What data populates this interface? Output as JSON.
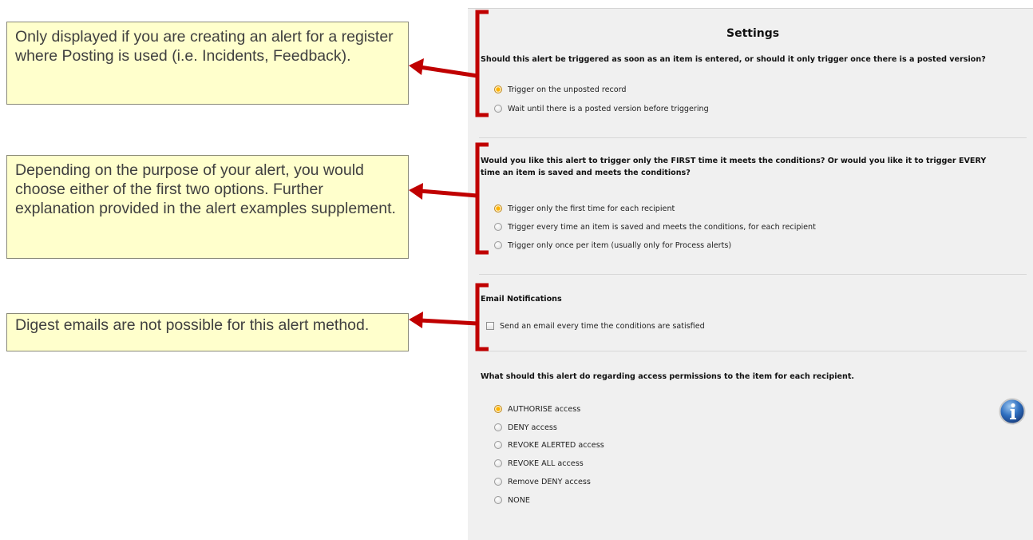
{
  "callouts": {
    "posting": "Only displayed if you are creating an alert for a register where Posting is used (i.e. Incidents, Feedback).",
    "trigger": "Depending on the purpose of your alert, you would choose either of the first two options. Further explanation provided in the alert examples supplement.",
    "digest": "Digest emails are not possible for this alert method."
  },
  "settings": {
    "title": "Settings",
    "posting_question": "Should this alert be triggered as soon as an item is entered, or should it only trigger once there is a posted version?",
    "posting_options": [
      {
        "label": "Trigger on the unposted record",
        "selected": true
      },
      {
        "label": "Wait until there is a posted version before triggering",
        "selected": false
      }
    ],
    "frequency_question_line1": "Would you like this alert to trigger only the FIRST time it meets the conditions? Or would you like it to trigger EVERY",
    "frequency_question_line2": "time an item is saved and meets the conditions?",
    "frequency_options": [
      {
        "label": "Trigger only the first time for each recipient",
        "selected": true
      },
      {
        "label": "Trigger every time an item is saved and meets the conditions, for each recipient",
        "selected": false
      },
      {
        "label": "Trigger only once per item (usually only for Process alerts)",
        "selected": false
      }
    ],
    "email_heading": "Email Notifications",
    "email_checkbox_label": "Send an email every time the conditions are satisfied",
    "email_checked": false,
    "access_question": "What should this alert do regarding access permissions to the item for each recipient.",
    "access_options": [
      {
        "label": "AUTHORISE access",
        "selected": true
      },
      {
        "label": "DENY access",
        "selected": false
      },
      {
        "label": "REVOKE ALERTED access",
        "selected": false
      },
      {
        "label": "REVOKE ALL access",
        "selected": false
      },
      {
        "label": "Remove DENY access",
        "selected": false
      },
      {
        "label": "NONE",
        "selected": false
      }
    ]
  },
  "colors": {
    "callout_bg": "#ffffcc",
    "annotation_red": "#c00000",
    "panel_bg": "#f0f0f0",
    "radio_selected": "#ffb300"
  },
  "icons": {
    "info": "info-icon"
  }
}
